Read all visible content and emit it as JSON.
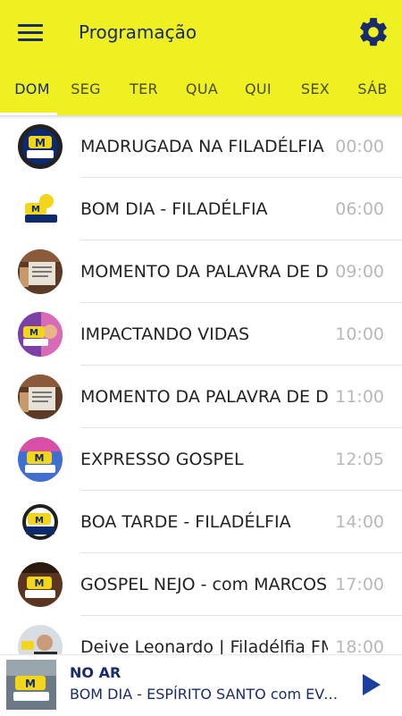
{
  "header": {
    "title": "Programação",
    "menu_icon": "hamburger-menu-icon",
    "settings_icon": "gear-icon",
    "background_color": "#eef021",
    "accent_color": "#1a2b6b"
  },
  "tabs": [
    {
      "label": "DOM",
      "active": true
    },
    {
      "label": "SEG",
      "active": false
    },
    {
      "label": "TER",
      "active": false
    },
    {
      "label": "QUA",
      "active": false
    },
    {
      "label": "QUI",
      "active": false
    },
    {
      "label": "SEX",
      "active": false
    },
    {
      "label": "SÁB",
      "active": false
    }
  ],
  "schedule": [
    {
      "name": "MADRUGADA NA FILADÉLFIA",
      "time": "00:00",
      "image": "mundo-ouve-logo"
    },
    {
      "name": "BOM DIA - FILADÉLFIA",
      "time": "06:00",
      "image": "mundo-ouve-logo"
    },
    {
      "name": "MOMENTO DA PALAVRA DE DEUS",
      "time": "09:00",
      "image": "book-photo"
    },
    {
      "name": "IMPACTANDO VIDAS",
      "time": "10:00",
      "image": "mundo-ouve-logo"
    },
    {
      "name": "MOMENTO DA PALAVRA DE DEUS",
      "time": "11:00",
      "image": "book-photo"
    },
    {
      "name": "EXPRESSO GOSPEL",
      "time": "12:05",
      "image": "mundo-ouve-logo"
    },
    {
      "name": "BOA TARDE - FILADÉLFIA",
      "time": "14:00",
      "image": "mundo-ouve-logo"
    },
    {
      "name": "GOSPEL NEJO - com MARCOS VINICIUS",
      "time": "17:00",
      "image": "mundo-ouve-logo"
    },
    {
      "name": "Deive Leonardo | Filadélfia FM",
      "time": "18:00",
      "image": "person-photo"
    }
  ],
  "player": {
    "status": "NO AR",
    "now_playing": "BOM DIA - ESPÍRITO SANTO com EVANDRO",
    "play_icon": "play-icon"
  }
}
